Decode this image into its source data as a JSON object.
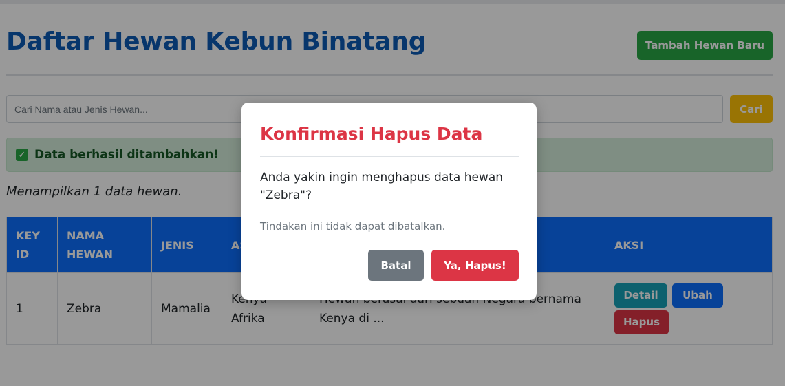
{
  "header": {
    "title": "Daftar Hewan Kebun Binatang",
    "add_button": "Tambah Hewan Baru"
  },
  "search": {
    "placeholder": "Cari Nama atau Jenis Hewan...",
    "button": "Cari"
  },
  "alert": {
    "message": "Data berhasil ditambahkan!",
    "icon": "check-square-icon"
  },
  "count_text": "Menampilkan 1 data hewan.",
  "table": {
    "headers": {
      "key_id": "KEY ID",
      "nama_hewan": "NAMA HEWAN",
      "jenis": "JENIS",
      "asal": "AS",
      "deskripsi": "",
      "aksi": "AKSI"
    },
    "rows": [
      {
        "key_id": "1",
        "nama": "Zebra",
        "jenis": "Mamalia",
        "asal": "Kenya Afrika",
        "deskripsi": "Hewan berasal dari sebuah Negara bernama Kenya di ...",
        "actions": {
          "detail": "Detail",
          "ubah": "Ubah",
          "hapus": "Hapus"
        }
      }
    ]
  },
  "modal": {
    "title": "Konfirmasi Hapus Data",
    "message": "Anda yakin ingin menghapus data hewan \"Zebra\"?",
    "note": "Tindakan ini tidak dapat dibatalkan.",
    "cancel": "Batal",
    "confirm": "Ya, Hapus!"
  },
  "colors": {
    "primary": "#0d6efd",
    "title": "#0d5bb5",
    "success": "#28a745",
    "warning": "#ffc107",
    "danger": "#dc3545",
    "info": "#17a2b8",
    "secondary": "#6c757d"
  }
}
